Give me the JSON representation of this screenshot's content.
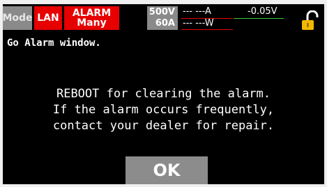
{
  "status_bar": {
    "mode_label": "Mode",
    "lan_label": "LAN",
    "alarm_line1": "ALARM",
    "alarm_line2": "Many",
    "voltage_spec": "500V",
    "current_spec": "60A",
    "current_reading": "--- ---A",
    "voltage_reading": "-0.05V",
    "power_reading": "--- ---W"
  },
  "lock_icon": "unlocked-padlock-icon",
  "alarm_window": {
    "header": "Go Alarm window.",
    "message_line1": "REBOOT for clearing the alarm.",
    "message_line2": "If the alarm occurs frequently,",
    "message_line3": "contact your dealer for repair.",
    "ok_label": "OK"
  },
  "colors": {
    "background": "#000000",
    "alarm_red": "#e60000",
    "badge_gray": "#8a8a8a",
    "current_line": "#e60000",
    "voltage_line": "#2ecc40",
    "power_line": "#e60000",
    "lock_yellow": "#f5b800"
  }
}
